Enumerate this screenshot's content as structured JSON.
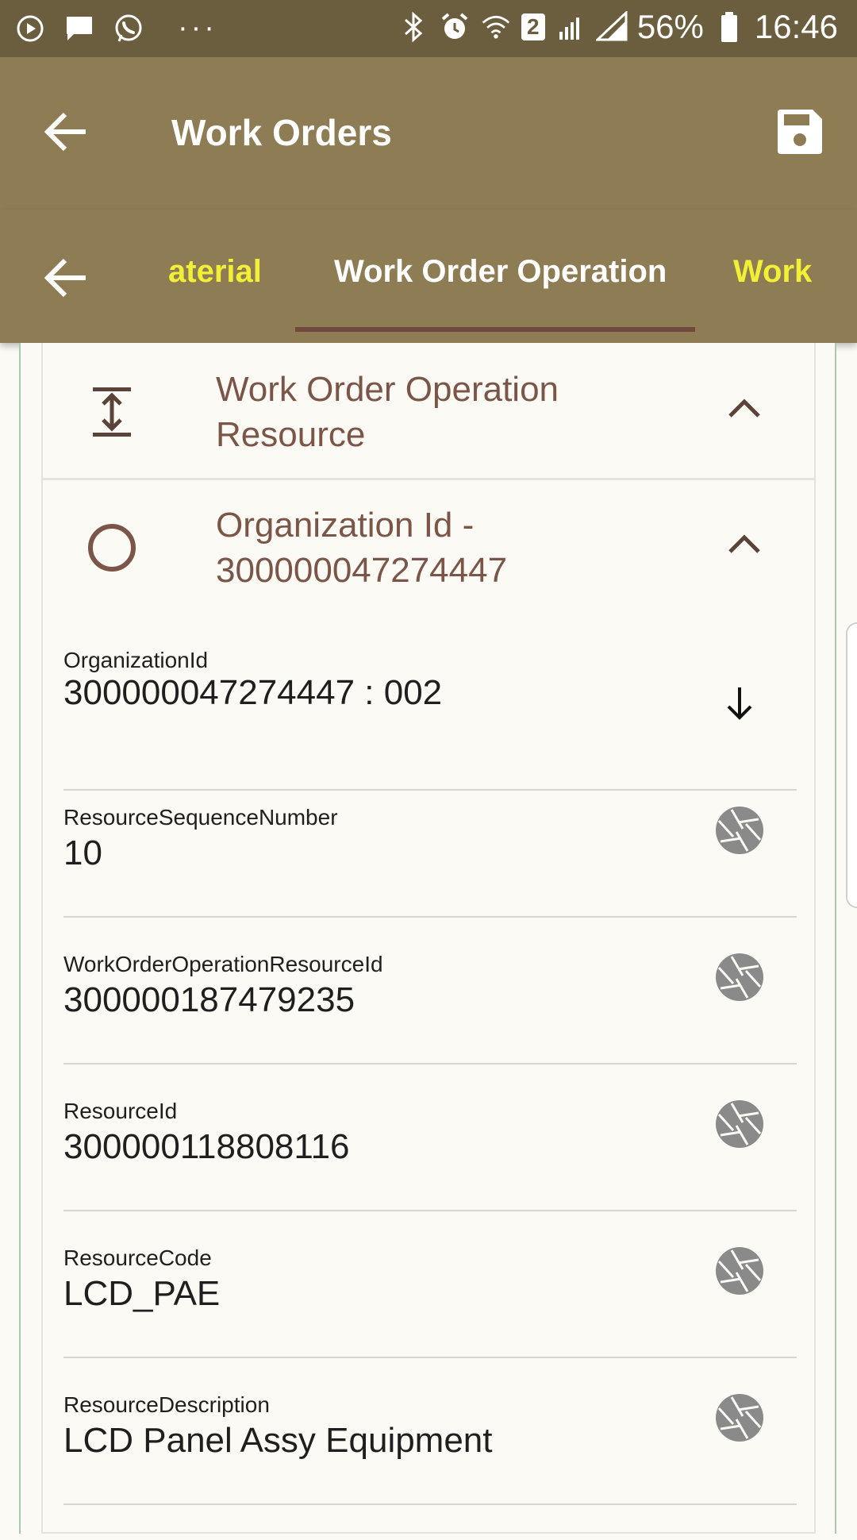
{
  "status_bar": {
    "battery": "56%",
    "time": "16:46",
    "sim_badge": "2",
    "dots": "···"
  },
  "app_bar": {
    "title": "Work Orders"
  },
  "tabs": [
    {
      "label": "Material",
      "visible_part": "aterial"
    },
    {
      "label": "Work Order Operation"
    },
    {
      "label": "Work"
    }
  ],
  "section": {
    "title": "Work Order Operation Resource"
  },
  "record": {
    "title": "Organization Id - 300000047274447"
  },
  "fields": [
    {
      "label": "OrganizationId",
      "value": "300000047274447 : 002",
      "icon": "arrow-down-icon"
    },
    {
      "label": "ResourceSequenceNumber",
      "value": "10",
      "icon": "aperture-icon"
    },
    {
      "label": "WorkOrderOperationResourceId",
      "value": "300000187479235",
      "icon": "aperture-icon"
    },
    {
      "label": "ResourceId",
      "value": "300000118808116",
      "icon": "aperture-icon"
    },
    {
      "label": "ResourceCode",
      "value": "LCD_PAE",
      "icon": "aperture-icon"
    },
    {
      "label": "ResourceDescription",
      "value": "LCD Panel Assy Equipment",
      "icon": "aperture-icon"
    }
  ],
  "colors": {
    "status_bar": "#6b5e3e",
    "app_bar": "#8e7d54",
    "tab_inactive": "#f2f036",
    "accent_brown": "#7b5548",
    "icon_gray": "#8a8a8a"
  }
}
